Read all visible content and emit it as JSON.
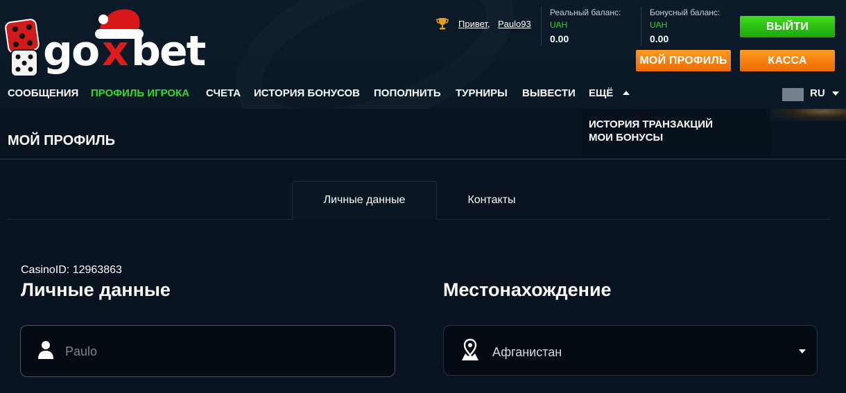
{
  "header": {
    "logo_text": "goxbet",
    "greeting": "Привет,",
    "username": "Paulo93",
    "real_balance": {
      "label": "Реальный баланс:",
      "currency": "UAH",
      "value": "0.00"
    },
    "bonus_balance": {
      "label": "Бонусный баланс:",
      "currency": "UAH",
      "value": "0.00"
    },
    "buttons": {
      "exit": "ВЫЙТИ",
      "profile": "МОЙ ПРОФИЛЬ",
      "cashier": "КАССА"
    }
  },
  "nav": {
    "items": [
      "СООБЩЕНИЯ",
      "ПРОФИЛЬ ИГРОКА",
      "СЧЕТА",
      "ИСТОРИЯ БОНУСОВ",
      "ПОПОЛНИТЬ",
      "ТУРНИРЫ",
      "ВЫВЕСТИ",
      "ЕЩЁ"
    ],
    "active_index": 1,
    "language": "RU",
    "more_menu": [
      "ИСТОРИЯ ТРАНЗАКЦИЙ",
      "МОИ БОНУСЫ"
    ]
  },
  "page": {
    "title": "МОЙ ПРОФИЛЬ",
    "tabs": [
      {
        "label": "Личные данные",
        "active": true
      },
      {
        "label": "Контакты",
        "active": false
      }
    ],
    "casino_id": "CasinoID: 12963863",
    "personal": {
      "title": "Личные данные",
      "name_placeholder": "Paulo"
    },
    "location": {
      "title": "Местонахождение",
      "country": "Афганистан"
    }
  },
  "colors": {
    "background": "#08131f",
    "accent_green": "#38d830",
    "accent_orange": "#ff8c12",
    "currency_green": "#34d134"
  }
}
